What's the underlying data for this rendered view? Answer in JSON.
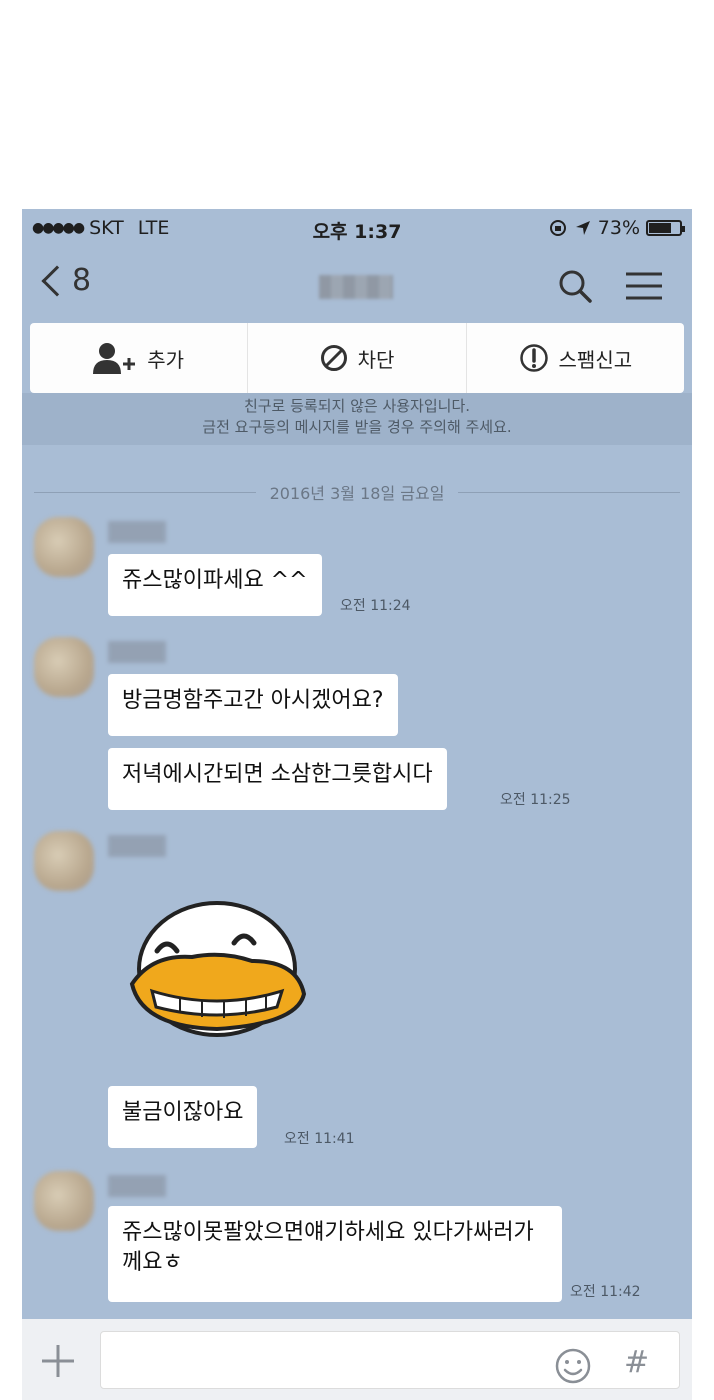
{
  "status_bar": {
    "carrier": "SKT",
    "network": "LTE",
    "time": "오후 1:37",
    "battery": "73%",
    "battery_level": 0.73
  },
  "header": {
    "back_count": "8"
  },
  "actions": [
    {
      "label": "추가",
      "icon": "add-friend-icon"
    },
    {
      "label": "차단",
      "icon": "block-icon"
    },
    {
      "label": "스팸신고",
      "icon": "report-icon"
    }
  ],
  "notice": {
    "line1": "친구로 등록되지 않은 사용자입니다.",
    "line2": "금전 요구등의 메시지를 받을 경우 주의해 주세요."
  },
  "date": "2016년 3월 18일 금요일",
  "messages": [
    {
      "text": "쥬스많이파세요 ^^",
      "time": "오전 11:24"
    },
    {
      "text": "방금명함주고간 아시겠어요?",
      "time": ""
    },
    {
      "text": "저녁에시간되면 소삼한그릇합시다",
      "time": "오전 11:25"
    },
    {
      "text": "불금이잖아요",
      "time": "오전 11:41"
    },
    {
      "text": "쥬스많이못팔았으면얘기하세요 있다가싸러가께요ㅎ",
      "time": "오전 11:42"
    }
  ],
  "input": {
    "plus_icon": "plus-icon",
    "emoji_icon": "emoji-icon",
    "hash_label": "#"
  },
  "colors": {
    "chat_background": "#a9bdd5",
    "bubble": "#ffffff",
    "emoticon_beak": "#f0a81c"
  }
}
